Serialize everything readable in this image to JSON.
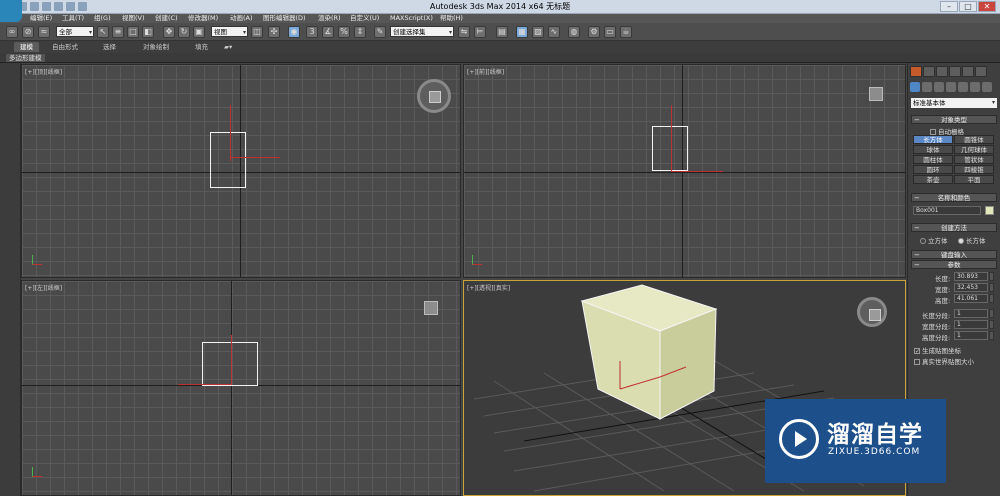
{
  "window": {
    "title": "Autodesk 3ds Max  2014 x64      无标题",
    "minimize": "–",
    "maximize": "□",
    "close": "✕"
  },
  "menu": [
    "编辑(E)",
    "工具(T)",
    "组(G)",
    "视图(V)",
    "创建(C)",
    "修改器(M)",
    "动画(A)",
    "图形编辑器(D)",
    "渲染(R)",
    "自定义(U)",
    "MAXScript(X)",
    "帮助(H)"
  ],
  "toolbar": {
    "selection_filter": "全部",
    "ref_coord": "视图",
    "named_selection": "创建选择集"
  },
  "ribbon": {
    "tabs": [
      "建模",
      "自由形式",
      "选择",
      "对象绘制",
      "填充"
    ],
    "active_tab": "建模",
    "subpanel_label": "多边形建模"
  },
  "viewports": {
    "top": "[+][顶][线框]",
    "front": "[+][前][线框]",
    "left": "[+][左][线框]",
    "perspective": "[+][透视][真实]"
  },
  "command_panel": {
    "category": "标准基本体",
    "object_type": {
      "title": "对象类型",
      "autogrid": "自动栅格",
      "buttons": [
        "长方体",
        "圆锥体",
        "球体",
        "几何球体",
        "圆柱体",
        "管状体",
        "圆环",
        "四棱锥",
        "茶壶",
        "平面"
      ],
      "active": "长方体"
    },
    "name_color": {
      "title": "名称和颜色",
      "name": "Box001",
      "color": "#e2e8b8"
    },
    "creation_method": {
      "title": "创建方法",
      "options": [
        "立方体",
        "长方体"
      ],
      "selected": "长方体"
    },
    "keyboard_entry": "键盘输入",
    "parameters": {
      "title": "参数",
      "length_label": "长度:",
      "length": "30.893",
      "width_label": "宽度:",
      "width": "32.453",
      "height_label": "高度:",
      "height": "41.061",
      "length_segs_label": "长度分段:",
      "length_segs": "1",
      "width_segs_label": "宽度分段:",
      "width_segs": "1",
      "height_segs_label": "高度分段:",
      "height_segs": "1",
      "gen_mapping": "生成贴图坐标",
      "real_world": "真实世界贴图大小"
    }
  },
  "watermark": {
    "title": "溜溜自学",
    "url": "ZIXUE.3D66.COM"
  }
}
